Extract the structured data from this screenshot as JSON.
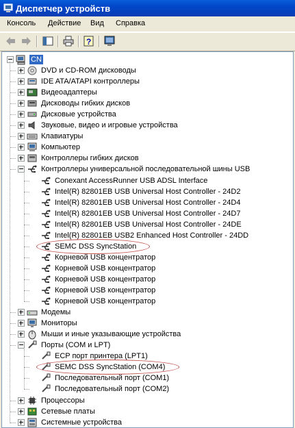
{
  "window": {
    "title": "Диспетчер устройств"
  },
  "menu": [
    "Консоль",
    "Действие",
    "Вид",
    "Справка"
  ],
  "toolbar": [
    {
      "name": "back-icon",
      "kind": "arrow-left"
    },
    {
      "name": "forward-icon",
      "kind": "arrow-right"
    },
    {
      "name": "show-hide-tree-icon",
      "kind": "panel"
    },
    {
      "name": "print-icon",
      "kind": "printer"
    },
    {
      "name": "help-icon",
      "kind": "help"
    },
    {
      "name": "properties-icon",
      "kind": "monitor"
    }
  ],
  "tree": {
    "root": "CN",
    "items": [
      {
        "label": "DVD и CD-ROM дисководы",
        "icon": "cdrom",
        "level": 1,
        "state": "collapsed"
      },
      {
        "label": "IDE ATA/ATAPI контроллеры",
        "icon": "ide",
        "level": 1,
        "state": "collapsed"
      },
      {
        "label": "Видеоадаптеры",
        "icon": "display",
        "level": 1,
        "state": "collapsed"
      },
      {
        "label": "Дисководы гибких дисков",
        "icon": "floppy",
        "level": 1,
        "state": "collapsed"
      },
      {
        "label": "Дисковые устройства",
        "icon": "disk",
        "level": 1,
        "state": "collapsed"
      },
      {
        "label": "Звуковые, видео и игровые устройства",
        "icon": "sound",
        "level": 1,
        "state": "collapsed"
      },
      {
        "label": "Клавиатуры",
        "icon": "keyboard",
        "level": 1,
        "state": "collapsed"
      },
      {
        "label": "Компьютер",
        "icon": "computer",
        "level": 1,
        "state": "collapsed"
      },
      {
        "label": "Контроллеры гибких дисков",
        "icon": "floppyctl",
        "level": 1,
        "state": "collapsed"
      },
      {
        "label": "Контроллеры универсальной последовательной шины USB",
        "icon": "usb",
        "level": 1,
        "state": "expanded"
      },
      {
        "label": "Conexant AccessRunner USB ADSL Interface",
        "icon": "usb",
        "level": 2
      },
      {
        "label": "Intel(R) 82801EB USB Universal Host Controller - 24D2",
        "icon": "usb",
        "level": 2
      },
      {
        "label": "Intel(R) 82801EB USB Universal Host Controller - 24D4",
        "icon": "usb",
        "level": 2
      },
      {
        "label": "Intel(R) 82801EB USB Universal Host Controller - 24D7",
        "icon": "usb",
        "level": 2
      },
      {
        "label": "Intel(R) 82801EB USB Universal Host Controller - 24DE",
        "icon": "usb",
        "level": 2
      },
      {
        "label": "Intel(R) 82801EB USB2 Enhanced Host Controller - 24DD",
        "icon": "usb",
        "level": 2
      },
      {
        "label": "SEMC DSS SyncStation",
        "icon": "usb",
        "level": 2,
        "circled": true
      },
      {
        "label": "Корневой USB концентратор",
        "icon": "usb",
        "level": 2
      },
      {
        "label": "Корневой USB концентратор",
        "icon": "usb",
        "level": 2
      },
      {
        "label": "Корневой USB концентратор",
        "icon": "usb",
        "level": 2
      },
      {
        "label": "Корневой USB концентратор",
        "icon": "usb",
        "level": 2
      },
      {
        "label": "Корневой USB концентратор",
        "icon": "usb",
        "level": 2
      },
      {
        "label": "Модемы",
        "icon": "modem",
        "level": 1,
        "state": "collapsed"
      },
      {
        "label": "Мониторы",
        "icon": "monitor",
        "level": 1,
        "state": "collapsed"
      },
      {
        "label": "Мыши и иные указывающие устройства",
        "icon": "mouse",
        "level": 1,
        "state": "collapsed"
      },
      {
        "label": "Порты (COM и LPT)",
        "icon": "port",
        "level": 1,
        "state": "expanded"
      },
      {
        "label": "ECP порт принтера (LPT1)",
        "icon": "port",
        "level": 2
      },
      {
        "label": "SEMC DSS SyncStation (COM4)",
        "icon": "port",
        "level": 2,
        "circled": true
      },
      {
        "label": "Последовательный порт (COM1)",
        "icon": "port",
        "level": 2
      },
      {
        "label": "Последовательный порт (COM2)",
        "icon": "port",
        "level": 2
      },
      {
        "label": "Процессоры",
        "icon": "cpu",
        "level": 1,
        "state": "collapsed"
      },
      {
        "label": "Сетевые платы",
        "icon": "network",
        "level": 1,
        "state": "collapsed"
      },
      {
        "label": "Системные устройства",
        "icon": "system",
        "level": 1,
        "state": "collapsed"
      }
    ]
  }
}
